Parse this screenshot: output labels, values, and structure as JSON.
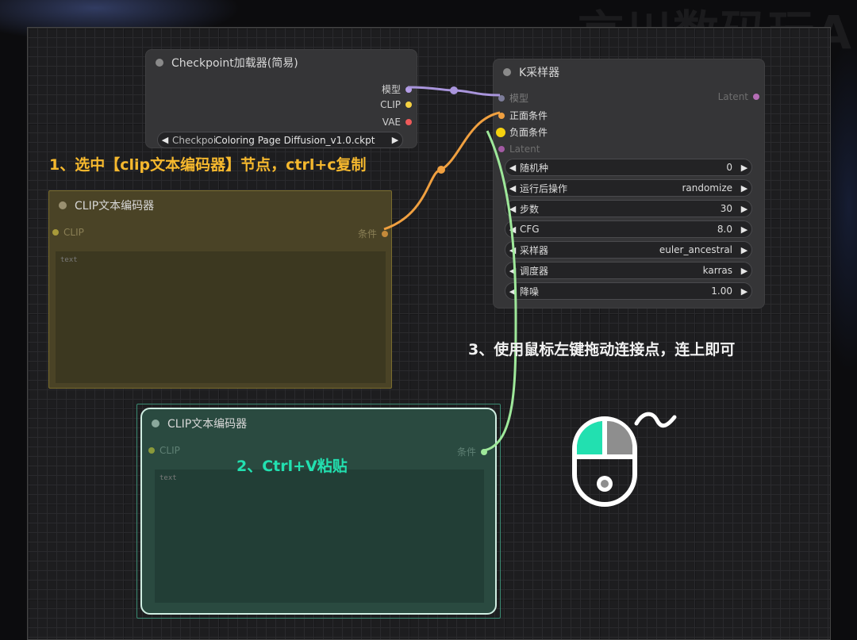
{
  "watermark": "言川数码玩AI",
  "checkpoint_node": {
    "title": "Checkpoint加载器(简易)",
    "outputs": [
      "模型",
      "CLIP",
      "VAE"
    ],
    "ckpt_name": "Coloring Page Diffusion_v1.0.ckpt",
    "widget_label": "Checkpoi"
  },
  "clip_node_original": {
    "title": "CLIP文本编码器",
    "input": "CLIP",
    "output": "条件",
    "placeholder": "text"
  },
  "clip_node_copy": {
    "title": "CLIP文本编码器",
    "input": "CLIP",
    "output": "条件",
    "placeholder": "text"
  },
  "ksampler_node": {
    "title": "K采样器",
    "inputs": [
      "模型",
      "正面条件",
      "负面条件",
      "Latent"
    ],
    "output": "Latent",
    "widgets": [
      {
        "label": "随机种",
        "value": "0"
      },
      {
        "label": "运行后操作",
        "value": "randomize"
      },
      {
        "label": "步数",
        "value": "30"
      },
      {
        "label": "CFG",
        "value": "8.0"
      },
      {
        "label": "采样器",
        "value": "euler_ancestral"
      },
      {
        "label": "调度器",
        "value": "karras"
      },
      {
        "label": "降噪",
        "value": "1.00"
      }
    ]
  },
  "annotations": {
    "step1": "1、选中【clip文本编码器】节点，ctrl+c复制",
    "step2": "2、Ctrl+V粘贴",
    "step3": "3、使用鼠标左键拖动连接点，连上即可"
  },
  "colors": {
    "model": "#b59ee8",
    "clip": "#f5d142",
    "vae": "#ee5a5a",
    "condition": "#f0a040",
    "latent": "#d27ad2",
    "accent_green": "#22e0b0",
    "wire_green": "#9ee89a",
    "annotation_yellow": "#f5b82e"
  },
  "icons": {
    "mouse": "mouse-left-click-icon"
  }
}
